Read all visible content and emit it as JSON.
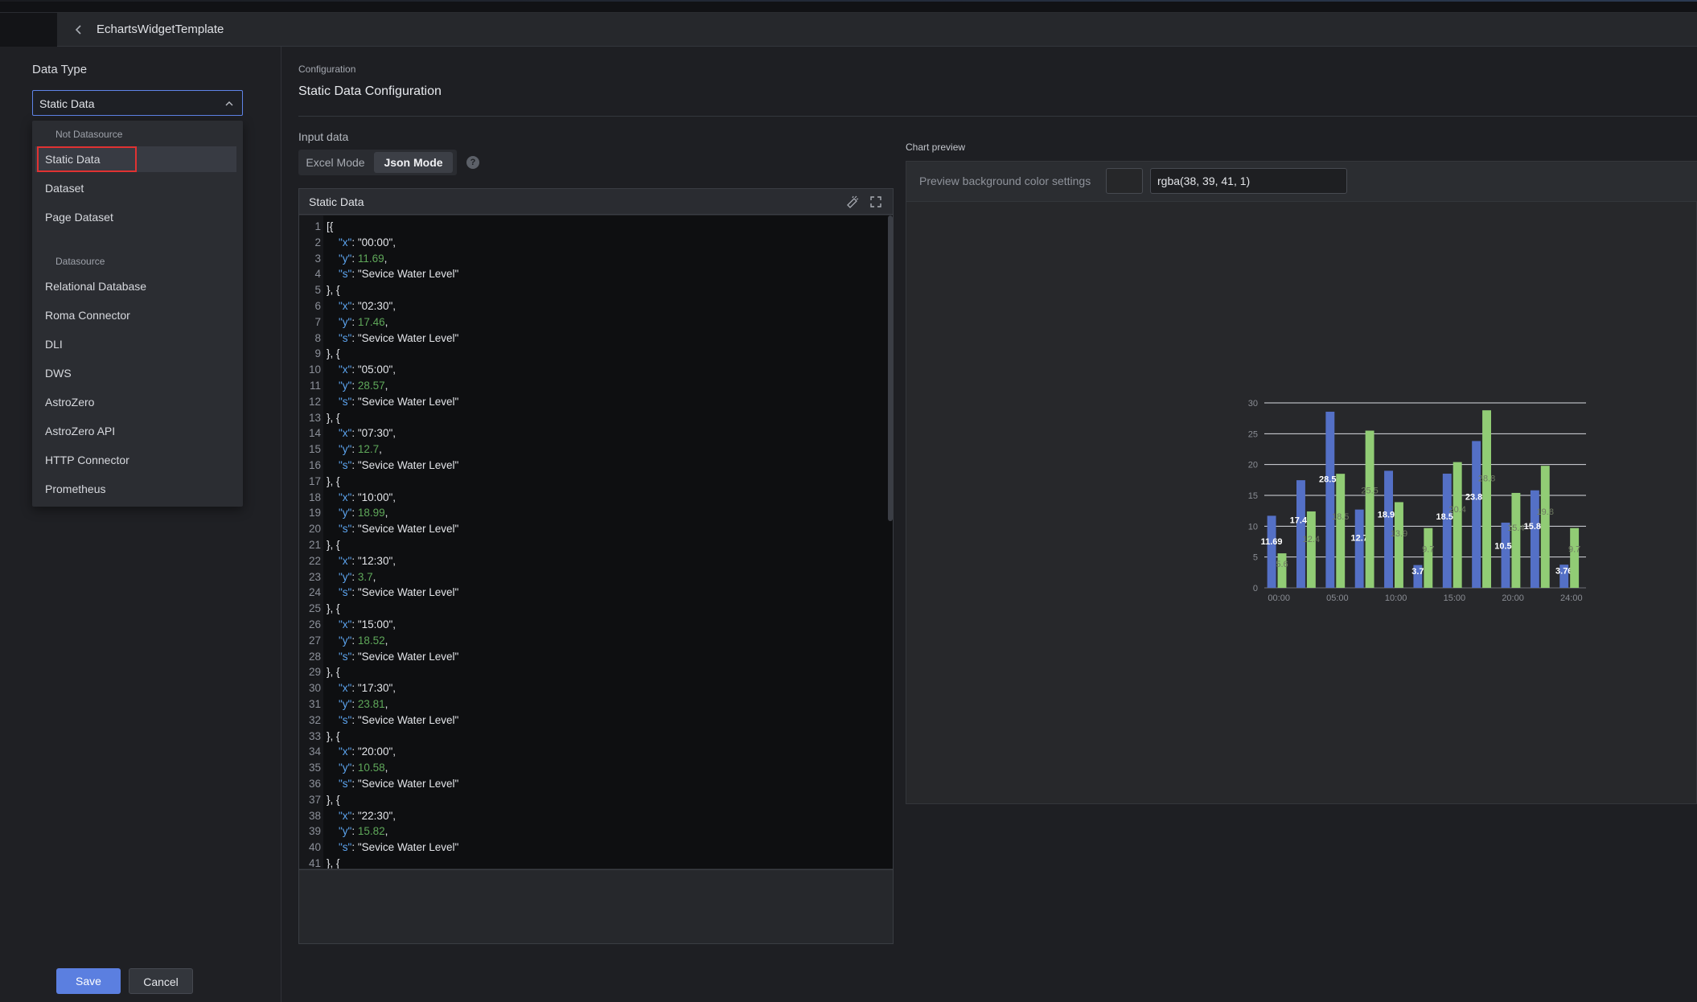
{
  "header": {
    "title": "EchartsWidgetTemplate"
  },
  "left": {
    "data_type_label": "Data Type",
    "selected": "Static Data",
    "groups": [
      {
        "label": "Not Datasource",
        "items": [
          "Static Data",
          "Dataset",
          "Page Dataset"
        ]
      },
      {
        "label": "Datasource",
        "items": [
          "Relational Database",
          "Roma Connector",
          "DLI",
          "DWS",
          "AstroZero",
          "AstroZero API",
          "HTTP Connector",
          "Prometheus"
        ]
      }
    ],
    "save_label": "Save",
    "cancel_label": "Cancel"
  },
  "main": {
    "config_small": "Configuration",
    "config_title": "Static Data Configuration",
    "input_label": "Input data",
    "modes": [
      "Excel Mode",
      "Json Mode"
    ],
    "active_mode": "Json Mode",
    "help": "?",
    "editor_title": "Static Data"
  },
  "code_lines": [
    "[{",
    "  \"x\": \"00:00\",",
    "  \"y\": 11.69,",
    "  \"s\": \"Sevice Water Level\"",
    "}, {",
    "  \"x\": \"02:30\",",
    "  \"y\": 17.46,",
    "  \"s\": \"Sevice Water Level\"",
    "}, {",
    "  \"x\": \"05:00\",",
    "  \"y\": 28.57,",
    "  \"s\": \"Sevice Water Level\"",
    "}, {",
    "  \"x\": \"07:30\",",
    "  \"y\": 12.7,",
    "  \"s\": \"Sevice Water Level\"",
    "}, {",
    "  \"x\": \"10:00\",",
    "  \"y\": 18.99,",
    "  \"s\": \"Sevice Water Level\"",
    "}, {",
    "  \"x\": \"12:30\",",
    "  \"y\": 3.7,",
    "  \"s\": \"Sevice Water Level\"",
    "}, {",
    "  \"x\": \"15:00\",",
    "  \"y\": 18.52,",
    "  \"s\": \"Sevice Water Level\"",
    "}, {",
    "  \"x\": \"17:30\",",
    "  \"y\": 23.81,",
    "  \"s\": \"Sevice Water Level\"",
    "}, {",
    "  \"x\": \"20:00\",",
    "  \"y\": 10.58,",
    "  \"s\": \"Sevice Water Level\"",
    "}, {",
    "  \"x\": \"22:30\",",
    "  \"y\": 15.82,",
    "  \"s\": \"Sevice Water Level\"",
    "}, {"
  ],
  "preview": {
    "label": "Chart preview",
    "bg_label": "Preview background color settings",
    "bg_value": "rgba(38, 39, 41, 1)",
    "bg_color": "#262729"
  },
  "colors": {
    "accent": "#5b7fe0",
    "series_blue": "#5470c6",
    "series_green": "#91cc75",
    "highlight_red": "#e03232"
  },
  "chart_data": {
    "type": "bar",
    "categories": [
      "00:00",
      "02:30",
      "05:00",
      "07:30",
      "10:00",
      "12:30",
      "15:00",
      "17:30",
      "20:00",
      "22:30",
      "24:00"
    ],
    "x_tick_labels": [
      "00:00",
      "05:00",
      "10:00",
      "15:00",
      "20:00",
      "24:00"
    ],
    "series": [
      {
        "values": [
          11.69,
          17.46,
          28.57,
          12.7,
          18.99,
          3.7,
          18.52,
          23.81,
          10.58,
          15.82,
          3.76
        ]
      },
      {
        "values": [
          5.6,
          12.4,
          18.5,
          25.5,
          13.9,
          9.7,
          20.4,
          28.8,
          15.4,
          19.8,
          9.7
        ]
      }
    ],
    "ylim": [
      0,
      30
    ],
    "y_ticks": [
      0,
      5,
      10,
      15,
      20,
      25,
      30
    ],
    "grid": true
  }
}
